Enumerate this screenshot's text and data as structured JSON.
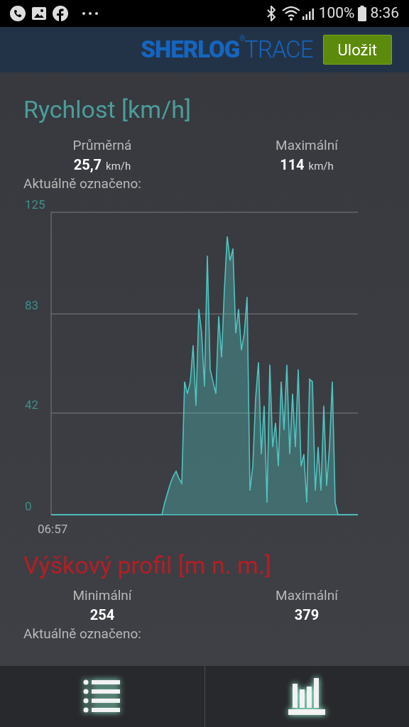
{
  "status_bar": {
    "battery": "100%",
    "time": "8:36"
  },
  "header": {
    "logo": "**SHERLOG**$^{®}$TRACE",
    "save_button": "Uložit"
  },
  "speed": {
    "title": "Rychlost [km/h]",
    "stats": [
      {
        "label": "Průměrná",
        "value": "25,7",
        "unit": "km/h"
      },
      {
        "label": "Maximální",
        "value": "114",
        "unit": "km/h"
      }
    ],
    "selected_label": "Aktuálně označeno:",
    "start_time": "06:57",
    "chart_data": {
      "type": "area",
      "ylim": [
        0,
        125
      ],
      "yticks": [
        0,
        42,
        83,
        125
      ],
      "series": [
        {
          "color": "#4fc4c0",
          "values": [
            0,
            0,
            0,
            0,
            0,
            0,
            0,
            0,
            0,
            0,
            0,
            0,
            0,
            0,
            0,
            0,
            0,
            0,
            0,
            0,
            0,
            0,
            0,
            0,
            0,
            0,
            0,
            0,
            0,
            0,
            0,
            0,
            0,
            0,
            0,
            0,
            0,
            0,
            0,
            0,
            5,
            9,
            13,
            16,
            18,
            15,
            13,
            55,
            50,
            55,
            70,
            45,
            85,
            75,
            53,
            107,
            60,
            55,
            50,
            82,
            65,
            93,
            115,
            105,
            110,
            75,
            85,
            68,
            75,
            90,
            10,
            20,
            48,
            63,
            25,
            45,
            5,
            62,
            28,
            38,
            20,
            55,
            35,
            62,
            25,
            50,
            28,
            60,
            20,
            25,
            5,
            56,
            55,
            10,
            28,
            10,
            45,
            12,
            28,
            55,
            5,
            0,
            0,
            0,
            0,
            0,
            0,
            0,
            0
          ]
        }
      ]
    }
  },
  "elevation": {
    "title": "Výškový profil [m n. m.]",
    "stats": [
      {
        "label": "Minimální",
        "value": "254"
      },
      {
        "label": "Maximální",
        "value": "379"
      }
    ],
    "selected_label": "Aktuálně označeno:"
  },
  "bottom_nav": [
    {
      "kind": "list"
    },
    {
      "kind": "chart"
    }
  ]
}
